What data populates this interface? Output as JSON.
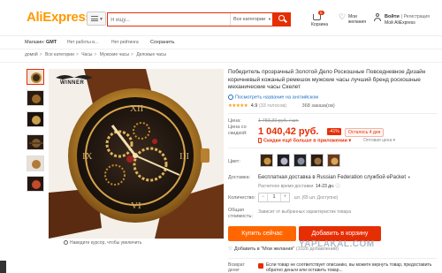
{
  "header": {
    "logo": "AliExpress",
    "search_placeholder": "Я ищу...",
    "search_category": "Все категории",
    "cart_count": "0",
    "cart_label": "Корзина",
    "wishlist_line1": "Мои",
    "wishlist_line2": "желания",
    "login": "Войти",
    "register": "| Регистрация",
    "my_account": "Мой AliExpress"
  },
  "store": {
    "label": "Магазин:",
    "name": "GMT",
    "item1": "Нет работы в...",
    "item2": "Нет рейтинга",
    "save": "Сохранить"
  },
  "breadcrumb": [
    "домой",
    "Все категории",
    "Часы",
    "Мужские часы",
    "Деловые часы"
  ],
  "product": {
    "brand_logo": "WINNER",
    "title": "Победитель прозрачный Золотой Дело Роскошные Повседневное Дизайн коричневый кожаный ремешок мужские часы лучший бренд роскошные механические часы Скелет",
    "translate": "Посмотреть название на английском",
    "stars": "★★★★★",
    "rating": "4.9",
    "rating_count": "(33 голосов)",
    "orders": "368 заказа(ов)",
    "price_label": "Цена:",
    "old_price": "1 783,30 руб. / шт.",
    "discount_label_1": "Цена со",
    "discount_label_2": "скидкой:",
    "new_price": "1 040,42 руб.",
    "discount_badge": "-41%",
    "time_left": "Осталось 4 дня",
    "app_promo": "Скидки ещё больше в приложении",
    "opt_price": "Оптовая цена",
    "color_label": "Цвет:",
    "shipping_label": "Доставка:",
    "shipping_text": "Бесплатная доставка в Russian Federation службой ePacket",
    "shipping_sub": "Расчетное время доставки:",
    "shipping_days": "14-23 дн.",
    "qty_label": "Количество:",
    "qty_minus": "−",
    "qty_value": "1",
    "qty_plus": "+",
    "qty_note": "шт. (65 шт. Доступно)",
    "total_label_1": "Общая",
    "total_label_2": "стоимость:",
    "total_note": "Зависит от выбранных характеристик товара",
    "buy_now": "Купить сейчас",
    "add_to_cart": "Добавить в корзину",
    "wishlist": "Добавить в \"Мои желания\"",
    "wishlist_count": "(1026 добавлений)",
    "protection_label_1": "Возврат",
    "protection_label_2": "денег",
    "protection_text": "Если товар не соответствует описанию, вы можете вернуть товар, предоставить обратно деньги или оставить товар...",
    "zoom_hint": "Наведите курсор, чтобы увеличить"
  },
  "watermark": "YAPLAKAL.COM",
  "colors": {
    "accent": "#e62e04",
    "buy_button": "#ff6600",
    "link": "#1a6fc4"
  }
}
